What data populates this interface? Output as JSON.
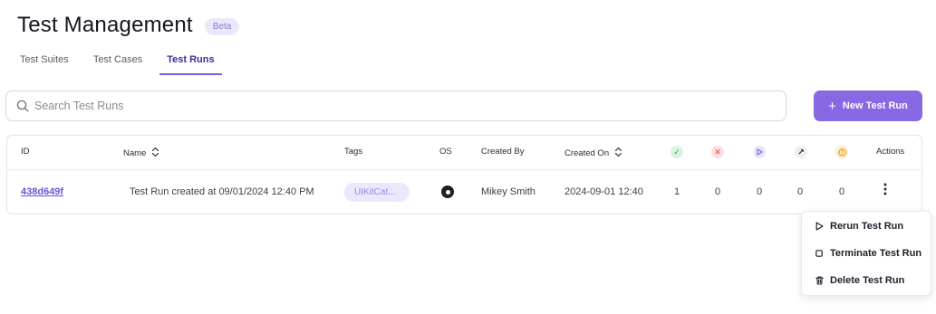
{
  "header": {
    "title": "Test Management",
    "badge": "Beta"
  },
  "tabs": [
    {
      "label": "Test Suites",
      "active": false
    },
    {
      "label": "Test Cases",
      "active": false
    },
    {
      "label": "Test Runs",
      "active": true
    }
  ],
  "search": {
    "placeholder": "Search Test Runs",
    "value": ""
  },
  "new_run_button": {
    "label": "New Test Run",
    "icon": "plus-icon"
  },
  "colors": {
    "accent": "#8868e3",
    "link": "#6c4fd9",
    "badge_bg": "#ece8fb",
    "passed": "#3aa15c",
    "failed": "#e0434b",
    "running": "#7b5ee6",
    "skipped": "#1f1f2b",
    "pending": "#f09a1a"
  },
  "table": {
    "headers": {
      "id": "ID",
      "name": "Name",
      "tags": "Tags",
      "os": "OS",
      "created_by": "Created By",
      "created_on": "Created On",
      "actions": "Actions"
    },
    "status_columns": [
      "passed-icon",
      "failed-icon",
      "running-icon",
      "skipped-icon",
      "pending-icon"
    ],
    "rows": [
      {
        "id": "438d649f",
        "name": "Test Run created at 09/01/2024 12:40 PM",
        "tag": "UIKitCat...",
        "os": "macos-icon",
        "created_by": "Mikey Smith",
        "created_on": "2024-09-01 12:40",
        "passed": "1",
        "failed": "0",
        "running": "0",
        "skipped": "0",
        "pending": "0"
      }
    ]
  },
  "actions_menu": {
    "items": [
      {
        "label": "Rerun Test Run",
        "icon": "play-icon"
      },
      {
        "label": "Terminate Test Run",
        "icon": "stop-icon"
      },
      {
        "label": "Delete Test Run",
        "icon": "trash-icon"
      }
    ]
  }
}
